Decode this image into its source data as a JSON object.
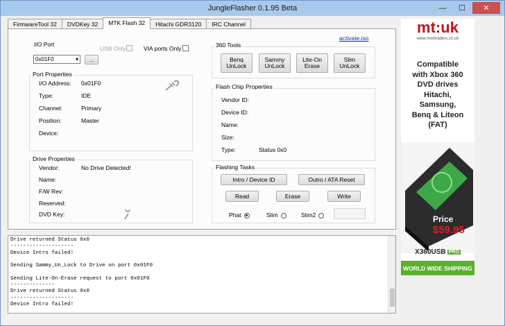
{
  "window": {
    "title": "JungleFlasher 0.1.95 Beta",
    "min": "—",
    "max": "☐",
    "close": "✕"
  },
  "tabs": [
    "FirmwareTool 32",
    "DVDKey 32",
    "MTK Flash 32",
    "Hitachi GDR3120",
    "IRC Channel"
  ],
  "activate_link": "activate.iso",
  "io_port": {
    "label": "I/O Port",
    "selected": "0x01F0",
    "browse_label": "...",
    "usb_only": "USB Only",
    "via_only": "VIA ports Only"
  },
  "port_properties": {
    "title": "Port Properties",
    "rows": [
      {
        "label": "I/O Address:",
        "value": "0x01F0"
      },
      {
        "label": "Type:",
        "value": "IDE"
      },
      {
        "label": "Channel:",
        "value": "Primary"
      },
      {
        "label": "Position:",
        "value": "Master"
      },
      {
        "label": "Device:",
        "value": ""
      }
    ]
  },
  "drive_properties": {
    "title": "Drive Properties",
    "rows": [
      {
        "label": "Vendor:",
        "value": "No Drive Detected!"
      },
      {
        "label": "Name:",
        "value": ""
      },
      {
        "label": "F/W Rev:",
        "value": ""
      },
      {
        "label": "Reserved:",
        "value": ""
      },
      {
        "label": "DVD Key:",
        "value": ""
      }
    ]
  },
  "tools360": {
    "title": "360 Tools",
    "buttons": [
      {
        "l1": "Benq",
        "l2": "UnLock"
      },
      {
        "l1": "Sammy",
        "l2": "UnLock"
      },
      {
        "l1": "Lite-On",
        "l2": "Erase"
      },
      {
        "l1": "Slim",
        "l2": "UnLock"
      }
    ]
  },
  "flash_chip": {
    "title": "Flash Chip Properties",
    "rows": [
      "Vendor ID:",
      "Device ID:",
      "Name:",
      "Size:",
      "Type:"
    ],
    "status": "Status 0x0"
  },
  "flashing": {
    "title": "Flashing Tasks",
    "intro": "Intro / Device ID",
    "outro": "Outro / ATA Reset",
    "read": "Read",
    "erase": "Erase",
    "write": "Write",
    "radios": [
      "Phat",
      "Slim",
      "Slim2"
    ],
    "selected": "Phat"
  },
  "log": [
    "Drive returned Status 0x0",
    "--------------------",
    "Device Intro failed!",
    "",
    "Sending Sammy_Un_Lock to Drive on port 0x01F0",
    "",
    "Sending Lite-On-Erase request to port 0x01F0",
    "--------------",
    "Drive returned Status 0x0",
    "--------------------",
    "Device Intro failed!"
  ],
  "ad": {
    "logo": "mt:uk",
    "logo_sub": "www.modtraders.co.uk",
    "line1": "Compatible",
    "line2": "with Xbox 360",
    "line3": "DVD drives",
    "line4": "Hitachi,",
    "line5": "Samsung,",
    "line6": "Benq & Liteon",
    "line7": "(FAT)",
    "price_label": "Price",
    "price": "$59.95",
    "brand": "X360USB",
    "brand_badge": "PRO",
    "shipping": "WORLD WIDE SHIPPING"
  }
}
